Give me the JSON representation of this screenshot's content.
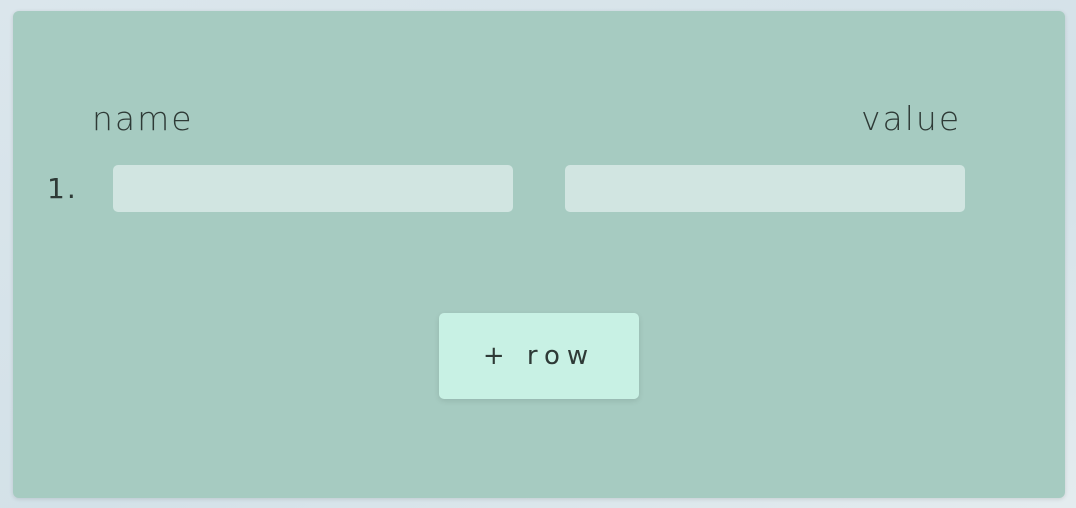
{
  "table": {
    "headers": {
      "name": "name",
      "value": "value"
    },
    "rows": [
      {
        "index_label": "1.",
        "name_value": "",
        "value_value": ""
      }
    ]
  },
  "actions": {
    "add_row_label": "+ row"
  },
  "colors": {
    "panel": "#a6cbc1",
    "field": "#d1e5e1",
    "button": "#c8f1e4",
    "text": "#2e3a36"
  }
}
